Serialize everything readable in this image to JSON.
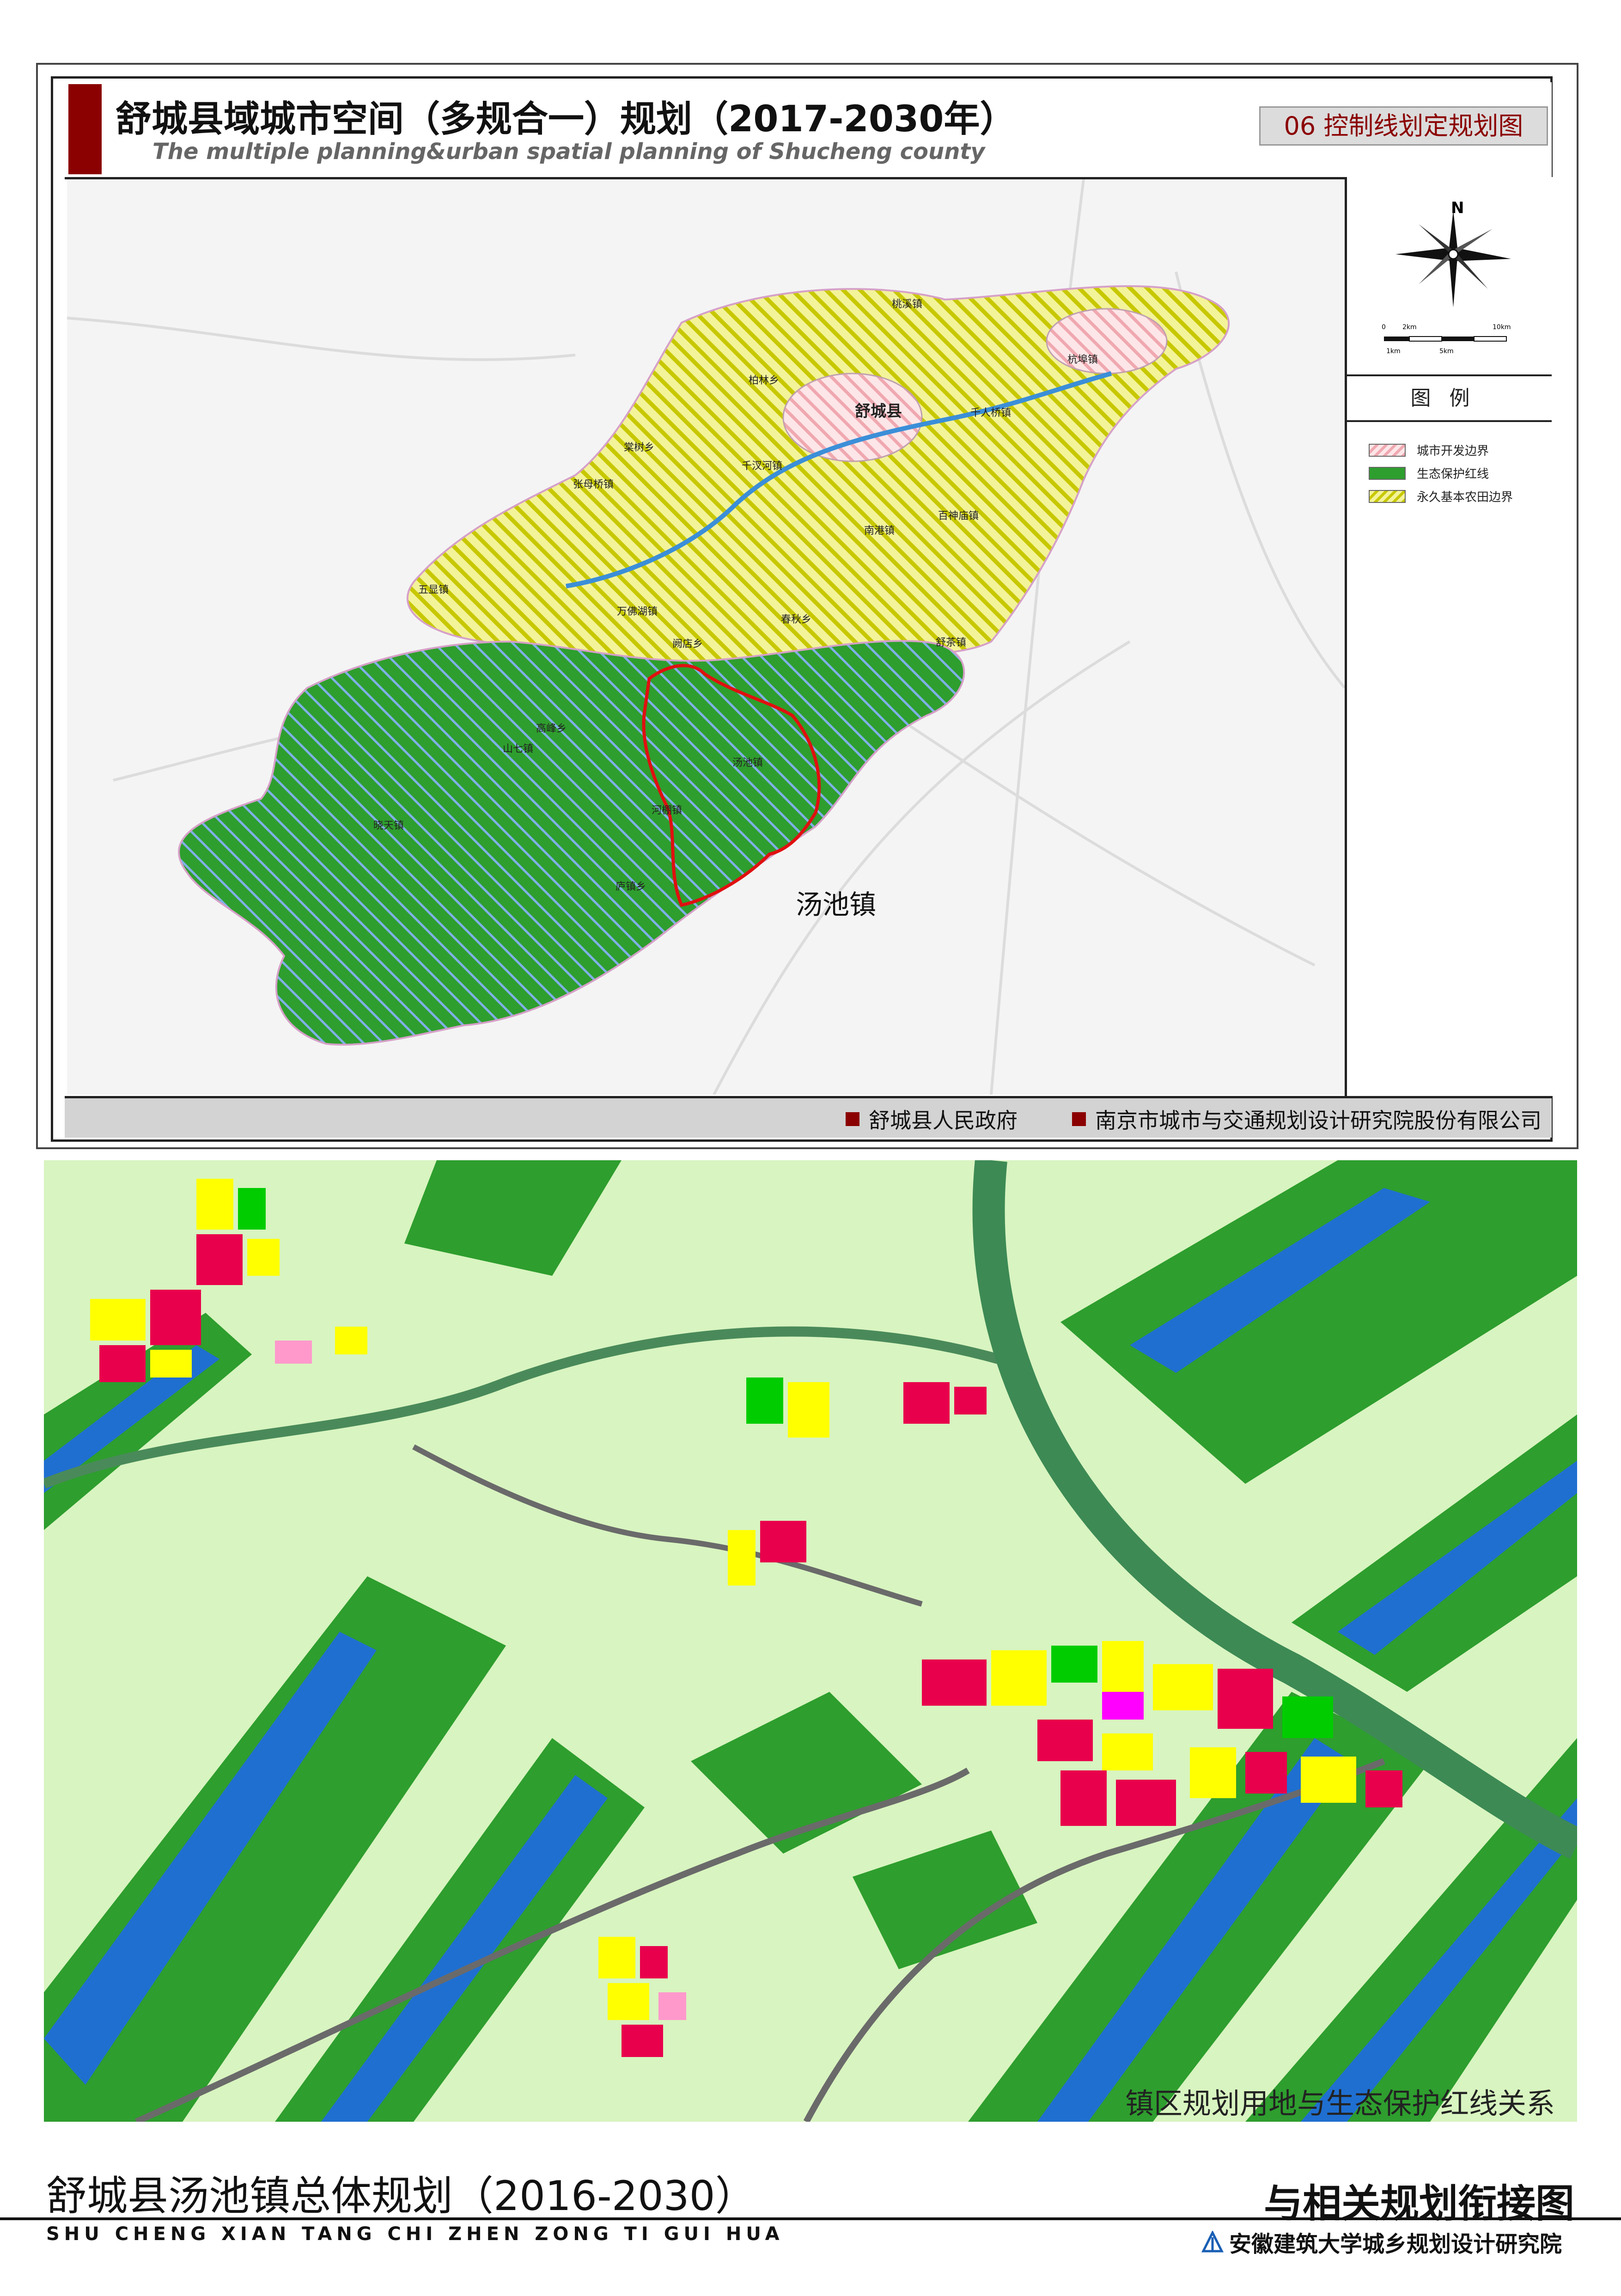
{
  "header": {
    "title_cn": "舒城县域城市空间（多规合一）规划（2017-2030年）",
    "title_en": "The multiple planning&urban spatial planning of Shucheng county",
    "map_number": "06 控制线划定规划图"
  },
  "compass": {
    "north_label": "N"
  },
  "scale_bar": {
    "labels": [
      "0",
      "2km",
      "10km",
      "1km",
      "5km"
    ]
  },
  "legend": {
    "heading": "图例",
    "items": [
      {
        "label": "城市开发边界",
        "color": "#f4c2c8",
        "hatch": true
      },
      {
        "label": "生态保护红线",
        "color": "#2e9e2e",
        "hatch": false
      },
      {
        "label": "永久基本农田边界",
        "color": "#e3e32c",
        "hatch": true
      }
    ]
  },
  "map_labels": {
    "county": "舒城县",
    "highlight_town": "汤池镇",
    "towns": [
      "桃溪镇",
      "杭埠镇",
      "柏林乡",
      "千人桥镇",
      "棠树乡",
      "千汊河镇",
      "张母桥镇",
      "百神庙镇",
      "南港镇",
      "五显镇",
      "万佛湖镇",
      "春秋乡",
      "阙店乡",
      "舒茶镇",
      "高峰乡",
      "山七镇",
      "汤池镇",
      "河棚镇",
      "晓天镇",
      "庐镇乡"
    ]
  },
  "footer": {
    "left_org": "舒城县人民政府",
    "right_org": "南京市城市与交通规划设计研究院股份有限公司"
  },
  "lower_map": {
    "caption": "镇区规划用地与生态保护红线关系"
  },
  "sheet": {
    "title_cn": "舒城县汤池镇总体规划（2016-2030）",
    "title_en": "SHU CHENG XIAN TANG CHI ZHEN ZONG TI GUI HUA",
    "sheet_title": "与相关规划衔接图",
    "institute": "安徽建筑大学城乡规划设计研究院"
  },
  "colors": {
    "accent_red": "#8b0000",
    "ecological_green": "#2e9e2e",
    "farmland_yellow": "#e3e32c",
    "urban_pink": "#f4c2c8",
    "base_lightgreen": "#d8f4c0",
    "water_blue": "#1f6fd1"
  }
}
